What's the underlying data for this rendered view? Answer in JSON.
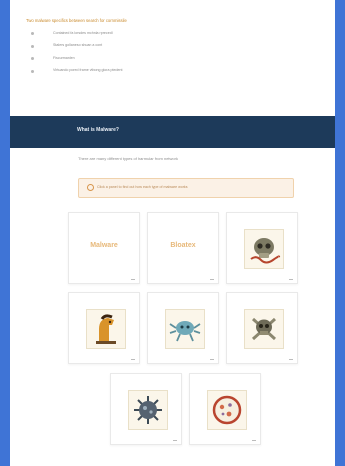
{
  "intro": {
    "title": "Two malware specifics between search for cornmissile",
    "bullets": [
      "Contained fa lorsdes mchnla rprecedl",
      "Stalers gollaneso shuan a cont",
      "Fiscurmanlen",
      "Virtuando pored frame vtbong glora ptedent"
    ]
  },
  "banner": {
    "title": "What is Malware?"
  },
  "section": {
    "subtitle": "There are many different types of harmular from network",
    "notice": "Click a panel to find out how each type of malware works"
  },
  "cards": [
    {
      "kind": "logo",
      "label": "Malware"
    },
    {
      "kind": "logo",
      "label": "Bloatex"
    },
    {
      "kind": "icon",
      "icon": "skull-worm-icon"
    },
    {
      "kind": "icon",
      "icon": "trojan-horse-icon"
    },
    {
      "kind": "icon",
      "icon": "bug-virus-icon"
    },
    {
      "kind": "icon",
      "icon": "skull-crossbones-icon"
    },
    {
      "kind": "icon",
      "icon": "spiky-virus-icon"
    },
    {
      "kind": "icon",
      "icon": "bacteria-dish-icon"
    }
  ],
  "colors": {
    "background": "#3f74d6",
    "banner": "#1d3a5a",
    "accent": "#c98a2c",
    "notice_bg": "#fbf1e6"
  }
}
